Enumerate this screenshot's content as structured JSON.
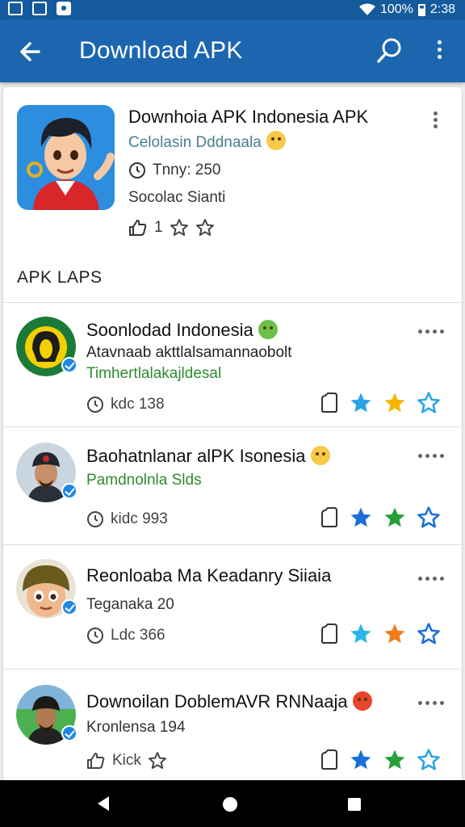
{
  "status_bar": {
    "battery": "100%",
    "time": "2:38"
  },
  "app_bar": {
    "title": "Download APK"
  },
  "featured": {
    "title": "Downhoia APK Indonesia APK",
    "subtitle": "Celolasin Dddnaala",
    "meta": "Tnny: 250",
    "developer": "Socolac Sianti",
    "rating_text": "1"
  },
  "section_title": "APK LAPS",
  "apps": [
    {
      "title": "Soonlodad Indonesia",
      "line1": "Atavnaab akttlalsamannaobolt",
      "line2": "Timhertlalakajldesal",
      "meta": "kdc 138",
      "stars": [
        "#29a3e6",
        "#f5b400",
        "#29a3e6"
      ],
      "last_outline": true
    },
    {
      "title": "Baohatnlanar alPK Isonesia",
      "line1": "",
      "line2": "Pamdnolnla Slds",
      "meta": "kidc 993",
      "stars": [
        "#1a6fd8",
        "#27a03a",
        "#1a6fd8"
      ],
      "last_outline": true
    },
    {
      "title": "Reonloaba Ma Keadanry Siiaia",
      "line1": "Teganaka 20",
      "line2": "",
      "meta": "Ldc 366",
      "stars": [
        "#29b6e6",
        "#f07d1a",
        "#1a6fd8"
      ],
      "last_outline": true
    },
    {
      "title": "Downoilan DoblemAVR RNNaaja",
      "line1": "Kronlensa 194",
      "line2": "",
      "meta": "Kick",
      "stars": [
        "#1a6fd8",
        "#27a03a",
        "#29a3e6"
      ],
      "last_outline": true
    }
  ]
}
